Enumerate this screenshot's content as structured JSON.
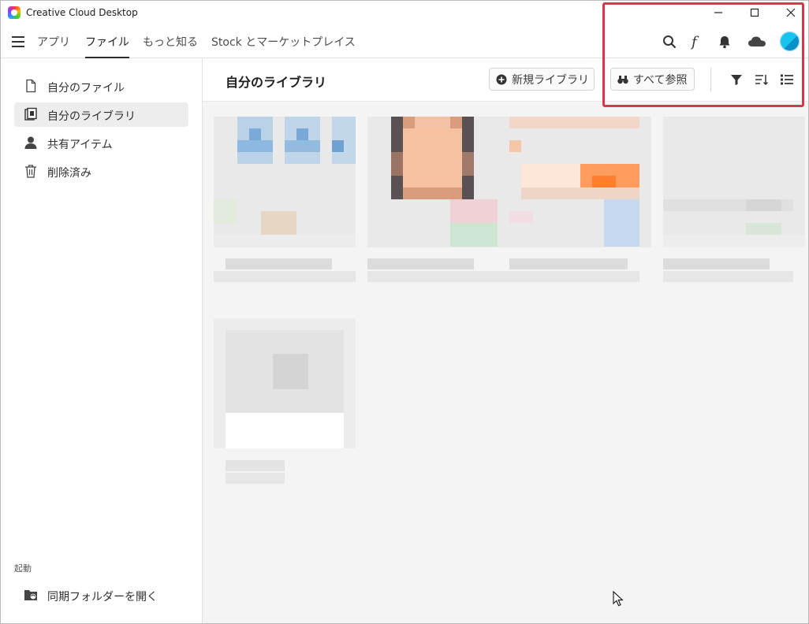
{
  "app": {
    "title": "Creative Cloud Desktop"
  },
  "window_controls": {
    "minimize_icon": "minimize-icon",
    "maximize_icon": "maximize-icon",
    "close_icon": "close-icon"
  },
  "nav": {
    "tabs": [
      {
        "label": "アプリ",
        "active": false
      },
      {
        "label": "ファイル",
        "active": true
      },
      {
        "label": "もっと知る",
        "active": false
      },
      {
        "label": "Stock とマーケットプレイス",
        "active": false
      }
    ],
    "icons": [
      "search-icon",
      "fonts-icon",
      "bell-icon",
      "cloud-icon",
      "avatar"
    ]
  },
  "sidebar": {
    "items": [
      {
        "label": "自分のファイル",
        "icon": "file-icon",
        "active": false
      },
      {
        "label": "自分のライブラリ",
        "icon": "library-icon",
        "active": true
      },
      {
        "label": "共有アイテム",
        "icon": "user-icon",
        "active": false
      },
      {
        "label": "削除済み",
        "icon": "trash-icon",
        "active": false
      }
    ],
    "section_label": "起動",
    "sync_folder_label": "同期フォルダーを開く"
  },
  "main": {
    "title": "自分のライブラリ",
    "new_library_label": "新規ライブラリ",
    "browse_all_label": "すべて参照",
    "toolbar_icons": [
      "filter-icon",
      "sort-icon",
      "list-view-icon"
    ]
  },
  "colors": {
    "accent_highlight": "#d9364c",
    "avatar": "#17c3ef",
    "content_bg": "#f4f4f4"
  }
}
